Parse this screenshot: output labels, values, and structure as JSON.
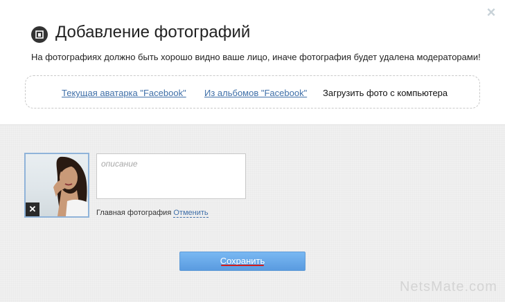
{
  "dialog": {
    "title": "Добавление фотографий",
    "subtitle": "На фотографиях должно быть хорошо видно ваше лицо, иначе фотография будет удалена модераторами!",
    "close_icon": "close-icon",
    "title_icon": "photo-badge-icon"
  },
  "tabs": [
    {
      "label": "Текущая аватарка \"Facebook\"",
      "active": false
    },
    {
      "label": "Из альбомов \"Facebook\"",
      "active": false
    },
    {
      "label": "Загрузить фото с компьютера",
      "active": true
    }
  ],
  "upload": {
    "description_placeholder": "описание",
    "description_value": "",
    "main_photo_label": "Главная фотография",
    "cancel_label": "Отменить",
    "remove_icon": "remove-icon"
  },
  "actions": {
    "save_label": "Сохранить"
  },
  "watermark": "NetsMate.com",
  "colors": {
    "link": "#3f6fa8",
    "button": "#6aaae9",
    "highlight_underline": "#d21c1c"
  }
}
